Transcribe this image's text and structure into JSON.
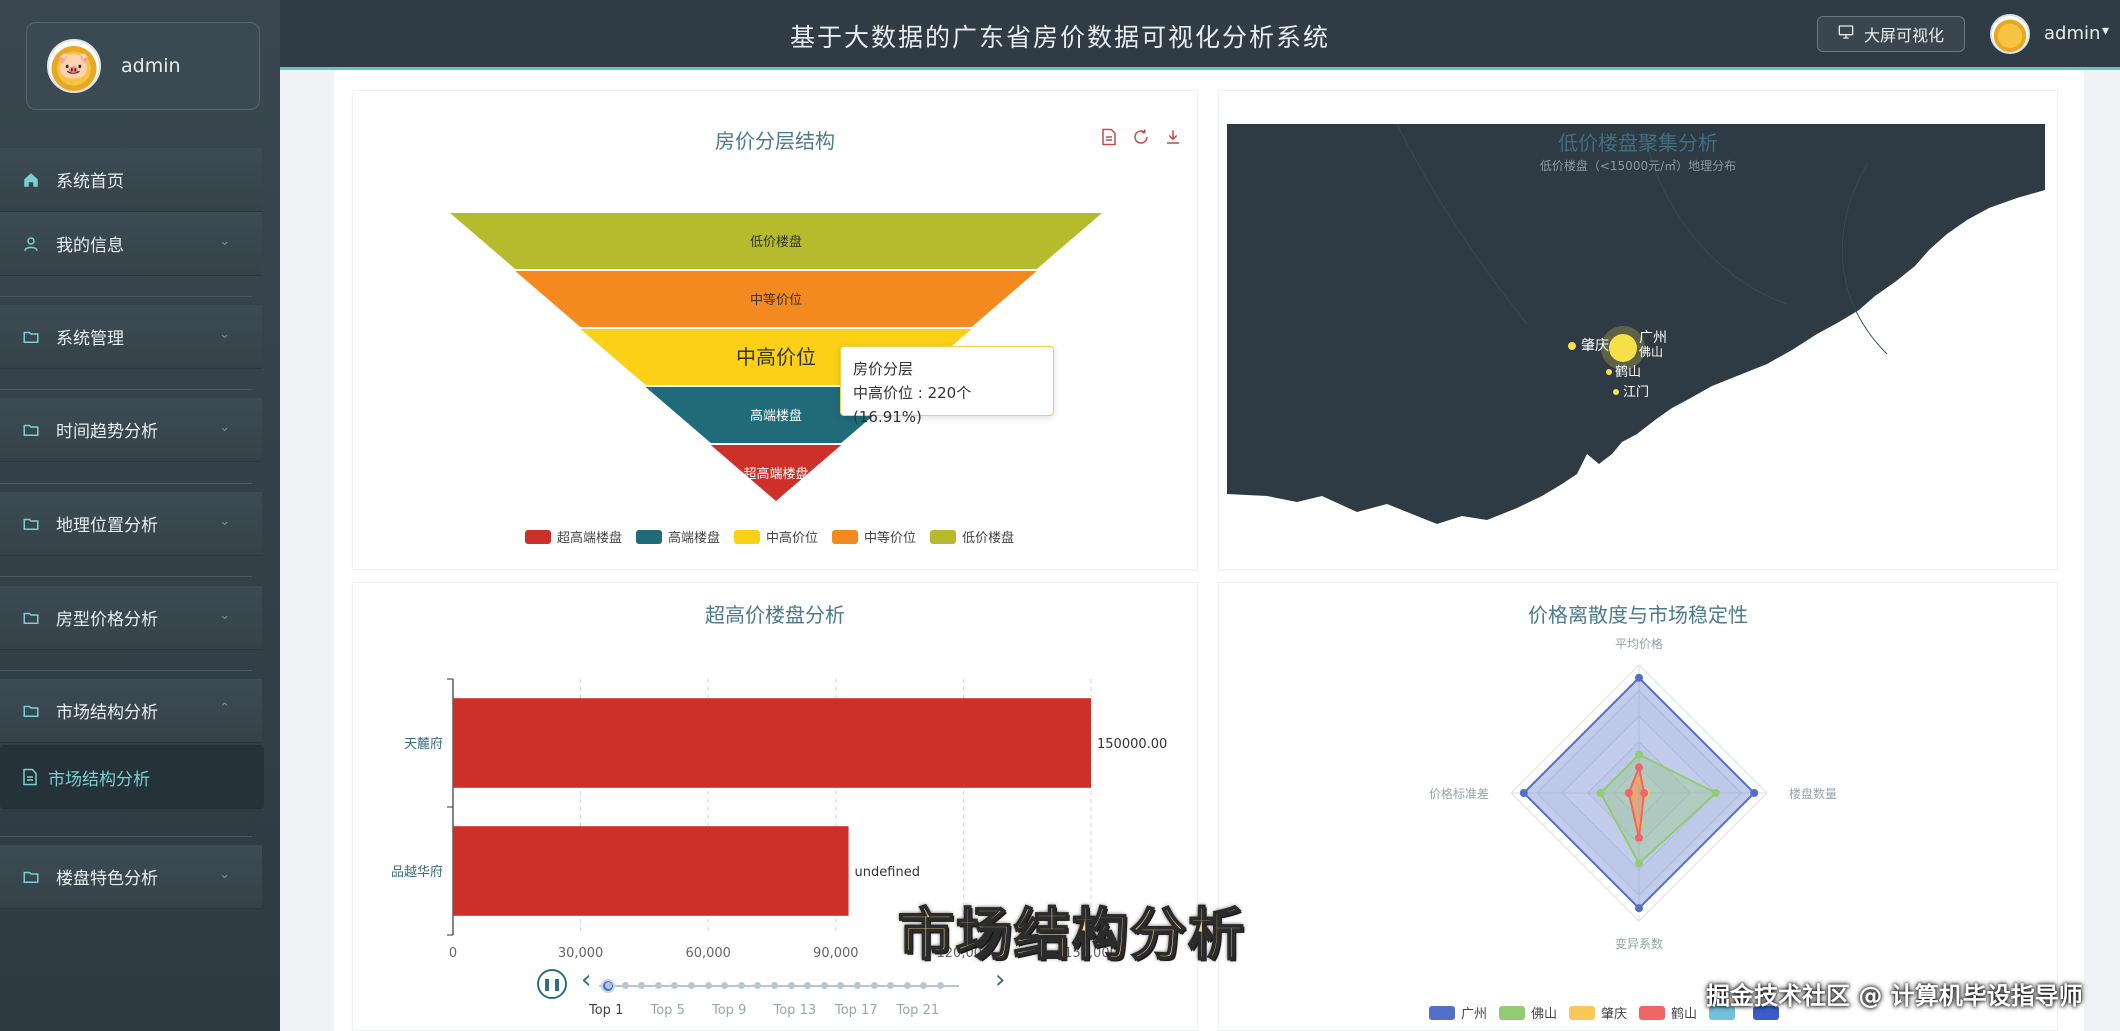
{
  "header": {
    "title": "基于大数据的广东省房价数据可视化分析系统",
    "big_screen_label": "大屏可视化",
    "user_name": "admin"
  },
  "sidebar": {
    "user_name": "admin",
    "items": [
      {
        "label": "系统首页",
        "icon": "home-icon",
        "has_chevron": false
      },
      {
        "label": "我的信息",
        "icon": "user-icon",
        "has_chevron": true
      },
      {
        "label": "系统管理",
        "icon": "folder-icon",
        "has_chevron": true
      },
      {
        "label": "时间趋势分析",
        "icon": "folder-icon",
        "has_chevron": true
      },
      {
        "label": "地理位置分析",
        "icon": "folder-icon",
        "has_chevron": true
      },
      {
        "label": "房型价格分析",
        "icon": "folder-icon",
        "has_chevron": true
      },
      {
        "label": "市场结构分析",
        "icon": "folder-icon",
        "has_chevron": true,
        "expanded": true
      },
      {
        "label": "楼盘特色分析",
        "icon": "folder-icon",
        "has_chevron": true
      }
    ],
    "subitem": {
      "label": "市场结构分析",
      "icon": "document-icon",
      "active": true
    }
  },
  "colors": {
    "accent": "#5ec6c6",
    "sidebar_bg": "#35424a",
    "header_bg": "#2f3c45",
    "funnel": [
      "#b5bb2d",
      "#f48a1f",
      "#fbd016",
      "#1f6b7a",
      "#cc3028"
    ],
    "bar": "#cc3028",
    "map_bg": "#2e3a44"
  },
  "charts": {
    "funnel": {
      "title": "房价分层结构",
      "tooltip": {
        "title": "房价分层",
        "line": "中高价位 : 220个 (16.91%)"
      }
    },
    "map": {
      "title": "低价楼盘聚集分析",
      "subtitle": "低价楼盘（<15000元/㎡）地理分布",
      "cities": [
        "肇庆",
        "广州",
        "佛山",
        "鹤山",
        "江门"
      ]
    },
    "bar": {
      "title": "超高价楼盘分析"
    },
    "radar": {
      "title": "价格离散度与市场稳定性"
    }
  },
  "timeline": {
    "labels": [
      "Top 1",
      "Top 5",
      "Top 9",
      "Top 13",
      "Top 17",
      "Top 21"
    ]
  },
  "overlay": {
    "caption": "市场结构分析",
    "watermark": "掘金技术社区 @ 计算机毕设指导师"
  },
  "chart_data": [
    {
      "type": "funnel",
      "title": "房价分层结构",
      "categories": [
        "低价楼盘",
        "中等价位",
        "中高价位",
        "高端楼盘",
        "超高端楼盘"
      ],
      "legend": [
        "超高端楼盘",
        "高端楼盘",
        "中高价位",
        "中等价位",
        "低价楼盘"
      ],
      "values": [
        null,
        null,
        220,
        null,
        null
      ],
      "highlight": "中高价位",
      "highlight_percent": 16.91
    },
    {
      "type": "bar",
      "title": "超高价楼盘分析",
      "orientation": "horizontal",
      "categories": [
        "天麓府",
        "品越华府"
      ],
      "values": [
        150000,
        93000
      ],
      "value_labels": [
        "150000.00",
        "undefined"
      ],
      "xlim": [
        0,
        150000
      ],
      "x_ticks": [
        "0",
        "30,000",
        "60,000",
        "90,000",
        "120,000",
        "150,000"
      ]
    },
    {
      "type": "radar",
      "title": "价格离散度与市场稳定性",
      "indicators": [
        "平均价格",
        "楼盘数量",
        "变异系数",
        "价格标准差"
      ],
      "series": [
        {
          "name": "广州",
          "values": [
            0.9,
            0.9,
            0.9,
            0.9
          ],
          "color": "#5470c6"
        },
        {
          "name": "佛山",
          "values": [
            0.3,
            0.6,
            0.55,
            0.3
          ],
          "color": "#91cc75"
        },
        {
          "name": "肇庆",
          "values": [
            0.1,
            0.05,
            0.25,
            0.05
          ],
          "color": "#fac858"
        },
        {
          "name": "鹤山",
          "values": [
            0.2,
            0.04,
            0.35,
            0.08
          ],
          "color": "#ee6666"
        },
        {
          "name": "",
          "values": [],
          "color": "#73c0de"
        },
        {
          "name": "",
          "values": [],
          "color": "#3b5bc9"
        }
      ]
    }
  ]
}
